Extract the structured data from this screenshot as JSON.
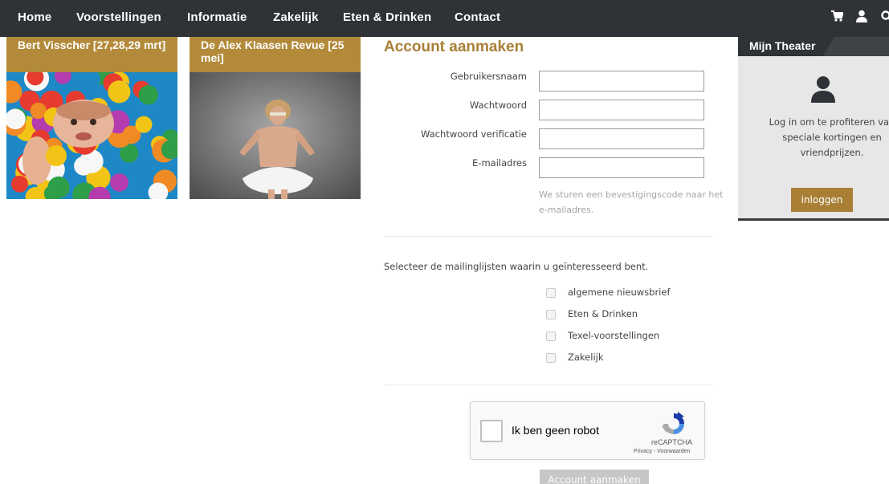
{
  "nav": {
    "items": [
      "Home",
      "Voorstellingen",
      "Informatie",
      "Zakelijk",
      "Eten & Drinken",
      "Contact"
    ],
    "icons": [
      "cart-icon",
      "user-icon",
      "search-icon"
    ]
  },
  "cards": [
    {
      "title": "Bert Visscher [27,28,29 mrt]"
    },
    {
      "title": "De Alex Klaasen Revue [25 mei]"
    }
  ],
  "form": {
    "title": "Account aanmaken",
    "fields": [
      {
        "label": "Gebruikersnaam",
        "value": ""
      },
      {
        "label": "Wachtwoord",
        "value": ""
      },
      {
        "label": "Wachtwoord verificatie",
        "value": ""
      },
      {
        "label": "E-mailadres",
        "value": ""
      }
    ],
    "email_hint": "We sturen een bevestigingscode naar het e-mailadres.",
    "mailing_intro": "Selecteer de mailinglijsten waarin u geïnteresseerd bent.",
    "mailing_lists": [
      "algemene nieuwsbrief",
      "Eten & Drinken",
      "Texel-voorstellingen",
      "Zakelijk"
    ],
    "submit_label": "Account aanmaken"
  },
  "recaptcha": {
    "label": "Ik ben geen robot",
    "brand": "reCAPTCHA",
    "links": "Privacy - Voorwaarden"
  },
  "sidebar": {
    "title": "Mijn Theater",
    "text": "Log in om te profiteren van speciale kortingen en vriendprijzen.",
    "login_label": "inloggen"
  },
  "colors": {
    "nav_bg": "#2f3237",
    "accent": "#b38a3a",
    "sidebar_bg": "#e7e7e7"
  }
}
